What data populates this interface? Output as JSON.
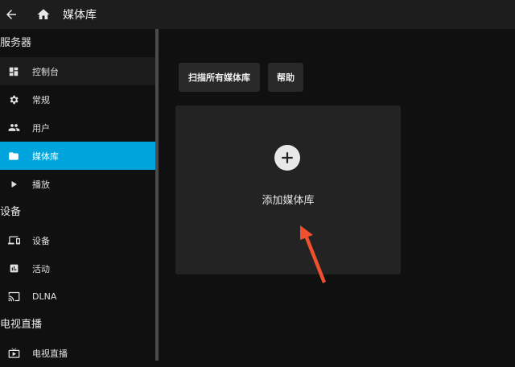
{
  "header": {
    "title": "媒体库",
    "icons": [
      "back-arrow-icon",
      "home-icon"
    ]
  },
  "sidebar": {
    "sections": [
      {
        "title": "服务器",
        "items": [
          {
            "label": "控制台",
            "icon": "dashboard-icon"
          },
          {
            "label": "常规",
            "icon": "gear-icon"
          },
          {
            "label": "用户",
            "icon": "people-icon"
          },
          {
            "label": "媒体库",
            "icon": "folder-icon",
            "active": true
          },
          {
            "label": "播放",
            "icon": "play-icon"
          }
        ]
      },
      {
        "title": "设备",
        "items": [
          {
            "label": "设备",
            "icon": "devices-icon"
          },
          {
            "label": "活动",
            "icon": "activity-icon"
          },
          {
            "label": "DLNA",
            "icon": "dlna-icon"
          }
        ]
      },
      {
        "title": "电视直播",
        "items": [
          {
            "label": "电视直播",
            "icon": "live-tv-icon"
          }
        ]
      }
    ]
  },
  "main": {
    "buttons": {
      "scan": "扫描所有媒体库",
      "help": "帮助"
    },
    "add_card": {
      "label": "添加媒体库",
      "icon": "plus-circle-icon"
    },
    "annotation": {
      "icon": "red-arrow-icon",
      "color": "#f0502e"
    }
  },
  "colors": {
    "accent": "#00a4dc",
    "topbar": "#1d1d1d",
    "background": "#101010",
    "card": "#232323"
  }
}
